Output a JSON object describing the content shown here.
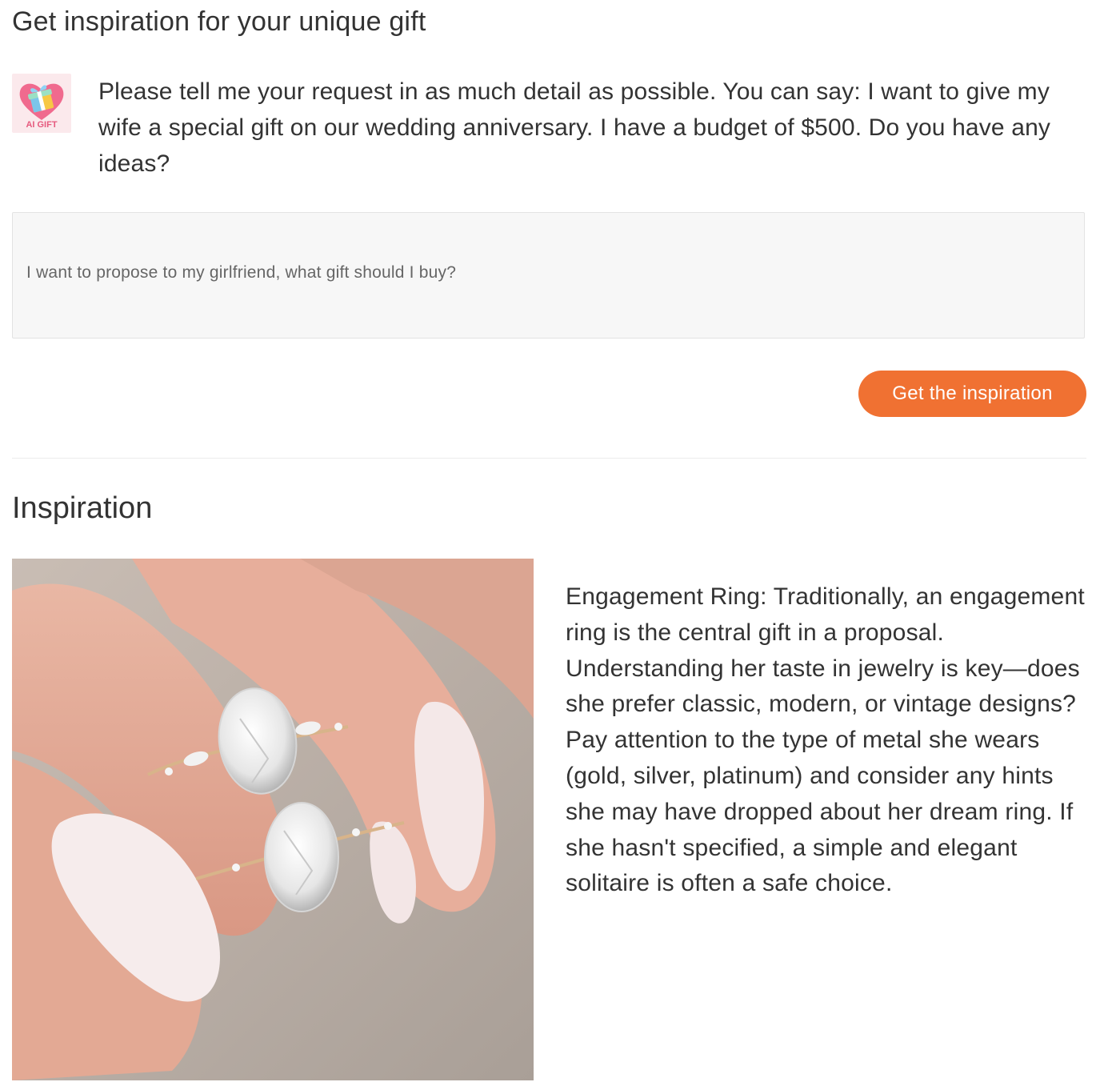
{
  "header": {
    "title": "Get inspiration for your unique gift"
  },
  "assistant": {
    "logo_icon": "ai-gift-heart-icon",
    "logo_text": "AI GIFT",
    "intro": "Please tell me your request in as much detail as possible. You can say: I want to give my wife a special gift on our wedding anniversary. I have a budget of $500. Do you have any ideas?"
  },
  "request": {
    "value": "I want to propose to my girlfriend, what gift should I buy?"
  },
  "actions": {
    "get_inspiration_label": "Get the inspiration"
  },
  "inspiration": {
    "heading": "Inspiration",
    "image_icon": "engagement-ring-photo",
    "text": "Engagement Ring: Traditionally, an engagement ring is the central gift in a proposal. Understanding her taste in jewelry is key—does she prefer classic, modern, or vintage designs? Pay attention to the type of metal she wears (gold, silver, platinum) and consider any hints she may have dropped about her dream ring. If she hasn't specified, a simple and elegant solitaire is often a safe choice."
  },
  "colors": {
    "accent": "#f07132",
    "text": "#333333",
    "input_bg": "#f7f7f7",
    "logo_bg": "#fbe9ec"
  }
}
